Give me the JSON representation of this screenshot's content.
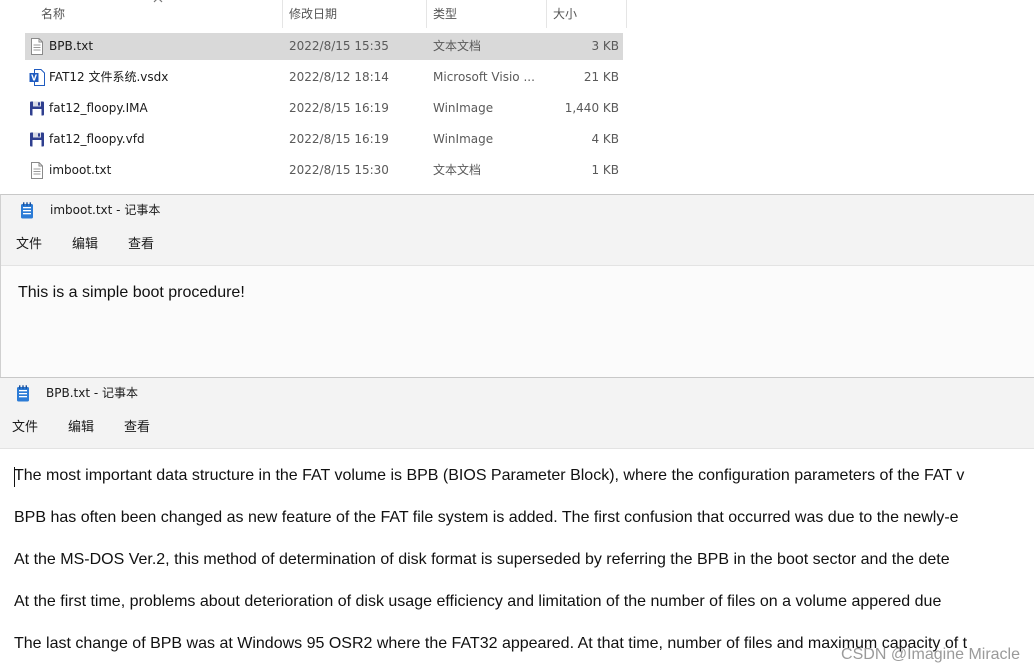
{
  "explorer": {
    "columns": {
      "name": "名称",
      "modified": "修改日期",
      "type": "类型",
      "size": "大小"
    },
    "files": [
      {
        "name": "BPB.txt",
        "modified": "2022/8/15 15:35",
        "type": "文本文档",
        "size": "3 KB",
        "icon": "text-file-icon",
        "selected": true
      },
      {
        "name": "FAT12 文件系统.vsdx",
        "modified": "2022/8/12 18:14",
        "type": "Microsoft Visio ...",
        "size": "21 KB",
        "icon": "visio-file-icon",
        "selected": false
      },
      {
        "name": "fat12_floopy.IMA",
        "modified": "2022/8/15 16:19",
        "type": "WinImage",
        "size": "1,440 KB",
        "icon": "floppy-disk-icon",
        "selected": false
      },
      {
        "name": "fat12_floopy.vfd",
        "modified": "2022/8/15 16:19",
        "type": "WinImage",
        "size": "4 KB",
        "icon": "floppy-disk-icon",
        "selected": false
      },
      {
        "name": "imboot.txt",
        "modified": "2022/8/15 15:30",
        "type": "文本文档",
        "size": "1 KB",
        "icon": "text-file-icon",
        "selected": false
      }
    ]
  },
  "notepad1": {
    "title": "imboot.txt - 记事本",
    "menu": [
      "文件",
      "编辑",
      "查看"
    ],
    "content": "This is a simple boot procedure!"
  },
  "notepad2": {
    "title": "BPB.txt - 记事本",
    "menu": [
      "文件",
      "编辑",
      "查看"
    ],
    "lines": [
      "The most important data structure in the FAT volume is BPB (BIOS Parameter Block), where the configuration parameters of the FAT v",
      "BPB has often been changed as new feature of the FAT file system is added. The first confusion that occurred was due to the newly-e",
      "At the MS-DOS Ver.2, this method of determination of disk format is superseded by referring the BPB in the boot sector and the dete",
      "At the first time, problems about deterioration of disk usage efficiency and limitation of the number of files on a volume appered due",
      "The last change of BPB was at Windows 95 OSR2 where the FAT32 appeared. At that time, number of files and maximum capacity of t"
    ]
  },
  "watermark": "CSDN @Imagine Miracle",
  "colors": {
    "selection": "#d9d9d9",
    "titlebar": "#f3f3f3",
    "notepad_icon": "#2b7bd6",
    "visio_blue": "#1f5bc0",
    "floppy_navy": "#2f3f8f"
  }
}
